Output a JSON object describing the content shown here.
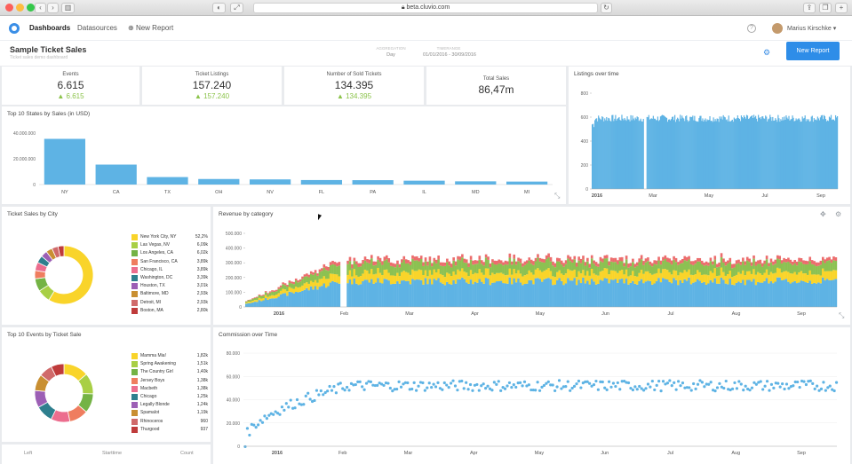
{
  "browser": {
    "url": "beta.cluvio.com"
  },
  "nav": {
    "dashboards": "Dashboards",
    "datasources": "Datasources",
    "new_report": "New Report",
    "help": "?",
    "user": "Marius Kirschke ▾"
  },
  "page": {
    "title": "Sample Ticket Sales",
    "subtitle": "Ticket sales demo dashboard",
    "aggregation_label": "AGGREGATION",
    "aggregation_value": "Day",
    "timerange_label": "TIMERANGE",
    "timerange_value": "01/01/2016 - 30/09/2016",
    "new_report_button": "New Report"
  },
  "kpis": [
    {
      "label": "Events",
      "value": "6.615",
      "delta": "▲ 6.615"
    },
    {
      "label": "Ticket Listings",
      "value": "157.240",
      "delta": "▲ 157.240"
    },
    {
      "label": "Number of Sold Tickets",
      "value": "134.395",
      "delta": "▲ 134.395"
    },
    {
      "label": "Total Sales",
      "value": "86,47m",
      "delta": ""
    }
  ],
  "panels": {
    "states": "Top 10 States by Sales (in USD)",
    "listings": "Listings over time",
    "city": "Ticket Sales by City",
    "revenue": "Revenue by category",
    "events": "Top 10 Events by Ticket Sale",
    "commission": "Commission over Time",
    "table_headers": [
      "Left",
      "Starttime",
      "Count"
    ]
  },
  "chart_data": [
    {
      "id": "states",
      "type": "bar",
      "title": "Top 10 States by Sales (in USD)",
      "categories": [
        "NY",
        "CA",
        "TX",
        "OH",
        "NV",
        "FL",
        "PA",
        "IL",
        "MD",
        "MI"
      ],
      "values": [
        35500000,
        15500000,
        5800000,
        4300000,
        4000000,
        3500000,
        3400000,
        3000000,
        2500000,
        2300000
      ],
      "ylim": [
        0,
        40000000
      ],
      "yticks": [
        "40.000.000",
        "20.000.000",
        "0"
      ],
      "color": "#5eb3e4"
    },
    {
      "id": "listings",
      "type": "bar",
      "title": "Listings over time",
      "x_ticks": [
        "2016",
        "Mar",
        "May",
        "Jul",
        "Sep"
      ],
      "y_ticks": [
        "800",
        "600",
        "400",
        "200",
        "0"
      ],
      "ylim": [
        0,
        800
      ],
      "series_level": 590,
      "days": 274,
      "color": "#5eb3e4"
    },
    {
      "id": "city",
      "type": "pie",
      "title": "Ticket Sales by City",
      "slices": [
        {
          "label": "New York City, NY",
          "value": "52,2%",
          "pct": 52.2,
          "color": "#f9d42a"
        },
        {
          "label": "Las Vegas, NV",
          "value": "6,09k",
          "pct": 6.4,
          "color": "#a8cf45"
        },
        {
          "label": "Los Angeles, CA",
          "value": "6,02k",
          "pct": 6.3,
          "color": "#74b345"
        },
        {
          "label": "San Francisco, CA",
          "value": "3,89k",
          "pct": 4.1,
          "color": "#ef7d5f"
        },
        {
          "label": "Chicago, IL",
          "value": "3,89k",
          "pct": 4.1,
          "color": "#ec6d8e"
        },
        {
          "label": "Washington, DC",
          "value": "3,39k",
          "pct": 3.6,
          "color": "#2e7f8e"
        },
        {
          "label": "Houston, TX",
          "value": "3,01k",
          "pct": 3.2,
          "color": "#9c5fb5"
        },
        {
          "label": "Baltimore, MD",
          "value": "2,93k",
          "pct": 3.1,
          "color": "#c98f32"
        },
        {
          "label": "Detroit, MI",
          "value": "2,93k",
          "pct": 3.1,
          "color": "#d06a6a"
        },
        {
          "label": "Boston, MA",
          "value": "2,80k",
          "pct": 2.9,
          "color": "#bf3b3b"
        }
      ]
    },
    {
      "id": "revenue",
      "type": "bar",
      "title": "Revenue by category",
      "stacked": true,
      "x_ticks": [
        "2016",
        "Feb",
        "Mar",
        "Apr",
        "May",
        "Jun",
        "Jul",
        "Aug",
        "Sep"
      ],
      "y_ticks": [
        "500.000",
        "400.000",
        "300.000",
        "200.000",
        "100.000",
        "0"
      ],
      "ylim": [
        0,
        500000
      ],
      "layers": [
        {
          "name": "base",
          "level": 175000,
          "color": "#5eb3e4"
        },
        {
          "name": "second",
          "level": 60000,
          "color": "#f9d42a"
        },
        {
          "name": "third",
          "level": 65000,
          "color": "#8cc152"
        },
        {
          "name": "fourth",
          "level": 25000,
          "color": "#ec6d6d"
        }
      ]
    },
    {
      "id": "events",
      "type": "pie",
      "title": "Top 10 Events by Ticket Sale",
      "slices": [
        {
          "label": "Mamma Mia!",
          "value": "1,82k",
          "pct": 13.6,
          "color": "#f9d42a"
        },
        {
          "label": "Spring Awakening",
          "value": "1,51k",
          "pct": 11.3,
          "color": "#a8cf45"
        },
        {
          "label": "The Country Girl",
          "value": "1,40k",
          "pct": 10.5,
          "color": "#74b345"
        },
        {
          "label": "Jersey Boys",
          "value": "1,38k",
          "pct": 10.3,
          "color": "#ef7d5f"
        },
        {
          "label": "Macbeth",
          "value": "1,38k",
          "pct": 10.3,
          "color": "#ec6d8e"
        },
        {
          "label": "Chicago",
          "value": "1,25k",
          "pct": 9.4,
          "color": "#2e7f8e"
        },
        {
          "label": "Legally Blonde",
          "value": "1,24k",
          "pct": 9.3,
          "color": "#9c5fb5"
        },
        {
          "label": "Spamalot",
          "value": "1,19k",
          "pct": 8.9,
          "color": "#c98f32"
        },
        {
          "label": "Rhinoceros",
          "value": "960",
          "pct": 7.2,
          "color": "#d06a6a"
        },
        {
          "label": "Thurgood",
          "value": "937",
          "pct": 7.0,
          "color": "#bf3b3b"
        }
      ]
    },
    {
      "id": "commission",
      "type": "scatter",
      "title": "Commission over Time",
      "x_ticks": [
        "2016",
        "Feb",
        "Mar",
        "Apr",
        "May",
        "Jun",
        "Jul",
        "Aug",
        "Sep"
      ],
      "y_ticks": [
        "80.000",
        "60.000",
        "40.000",
        "20.000",
        "0"
      ],
      "ylim": [
        0,
        80000
      ],
      "plateau": 52000,
      "color": "#5eb3e4"
    }
  ]
}
